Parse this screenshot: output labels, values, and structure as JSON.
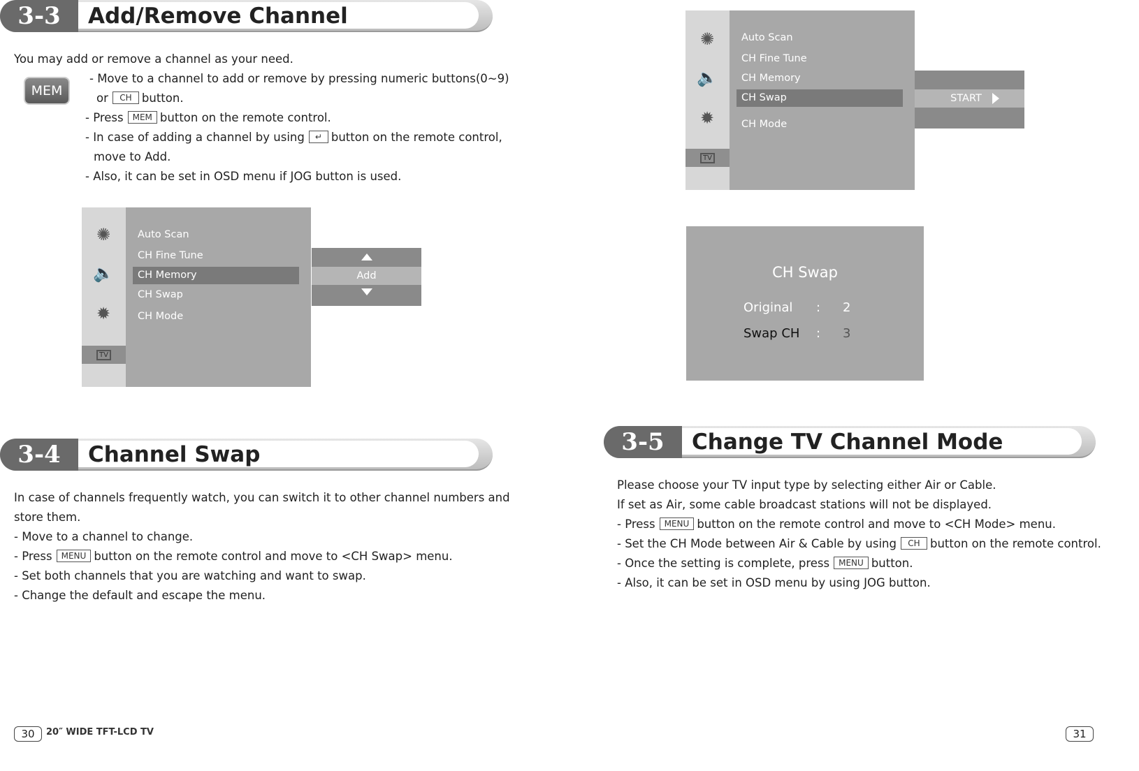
{
  "left_page": {
    "section_3_3": {
      "number": "3-3",
      "title": "Add/Remove Channel",
      "intro": "You may add or remove a channel as your need.",
      "mem_key_label": "MEM",
      "lines": [
        {
          "pre": "- Move to a channel to add or remove by pressing numeric buttons(0~9)"
        },
        {
          "pre": "or",
          "key": "CH",
          "post": "button."
        },
        {
          "pre": "- Press",
          "key": "MEM",
          "post": "button on the remote control."
        },
        {
          "pre": "- In case of adding a channel by using",
          "key": "↵",
          "post": "button on the remote control,"
        },
        {
          "pre": "move to Add."
        },
        {
          "pre": "- Also, it can be set in OSD menu if JOG button is used."
        }
      ],
      "osd": {
        "items": [
          "Auto Scan",
          "CH Fine Tune",
          "CH Memory",
          "CH Swap",
          "CH Mode"
        ],
        "highlighted": "CH Memory",
        "side_icons": [
          "picture-icon",
          "sound-icon",
          "setup-icon",
          "tv-icon"
        ],
        "popup_value": "Add"
      }
    },
    "section_3_4": {
      "number": "3-4",
      "title": "Channel Swap",
      "lines": [
        {
          "pre": "In case of channels frequently watch, you can switch it to other channel numbers and"
        },
        {
          "pre": "store them."
        },
        {
          "pre": "- Move to a channel to change."
        },
        {
          "pre": "- Press",
          "key": "MENU",
          "post": "button on the remote control and move to <CH Swap> menu."
        },
        {
          "pre": "- Set both channels that you are watching and want to swap."
        },
        {
          "pre": "- Change the default and escape the menu."
        }
      ]
    },
    "footer": {
      "page_number": "30",
      "model": "20″ WIDE TFT-LCD TV"
    }
  },
  "right_page": {
    "osd": {
      "items": [
        "Auto Scan",
        "CH Fine Tune",
        "CH Memory",
        "CH Swap",
        "CH Mode"
      ],
      "highlighted": "CH Swap",
      "side_icons": [
        "picture-icon",
        "sound-icon",
        "setup-icon",
        "tv-icon"
      ],
      "popup_value": "START"
    },
    "swap_dialog": {
      "title": "CH Swap",
      "rows": [
        {
          "label": "Original",
          "sep": ":",
          "value": "2"
        },
        {
          "label": "Swap CH",
          "sep": ":",
          "value": "3"
        }
      ]
    },
    "section_3_5": {
      "number": "3-5",
      "title": "Change TV Channel Mode",
      "lines": [
        {
          "pre": "Please choose your TV input type by selecting either Air or Cable."
        },
        {
          "pre": "If set as Air, some cable broadcast stations will not be displayed."
        },
        {
          "pre": "- Press",
          "key": "MENU",
          "post": "button on the remote control and move to <CH Mode> menu."
        },
        {
          "pre": "- Set the CH Mode between Air & Cable by using",
          "key": "CH",
          "post": "button on the remote control."
        },
        {
          "pre": "- Once the setting is complete, press",
          "key": "MENU",
          "post": "button."
        },
        {
          "pre": "- Also, it can be set in OSD menu by using JOG button."
        }
      ]
    },
    "footer": {
      "page_number": "31"
    }
  }
}
